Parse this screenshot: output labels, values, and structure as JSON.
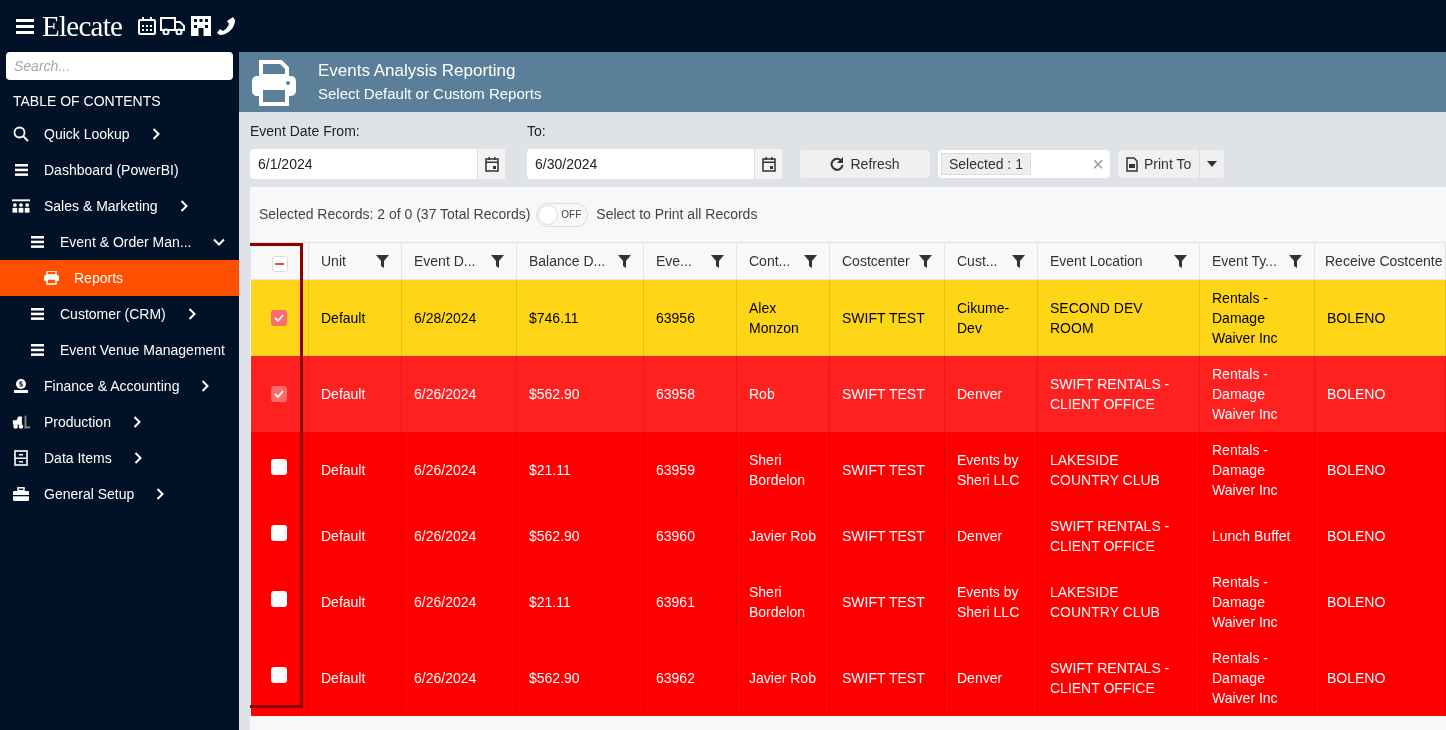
{
  "app": {
    "brand": "Elecate"
  },
  "sidebar": {
    "search_placeholder": "Search...",
    "heading": "TABLE OF CONTENTS",
    "items": [
      {
        "label": "Quick Lookup",
        "expanded": false,
        "selected": false
      },
      {
        "label": "Dashboard (PowerBI)",
        "selected": false
      },
      {
        "label": "Sales & Marketing",
        "expanded": false,
        "selected": false,
        "children": [
          {
            "label": "Event & Order Man...",
            "expanded": true,
            "selected": false,
            "children": [
              {
                "label": "Reports",
                "selected": true
              }
            ]
          },
          {
            "label": "Customer (CRM)",
            "expanded": false,
            "selected": false
          },
          {
            "label": "Event Venue Management",
            "selected": false
          }
        ]
      },
      {
        "label": "Finance & Accounting",
        "expanded": false,
        "selected": false
      },
      {
        "label": "Production",
        "expanded": false,
        "selected": false
      },
      {
        "label": "Data Items",
        "expanded": false,
        "selected": false
      },
      {
        "label": "General Setup",
        "expanded": false,
        "selected": false
      }
    ]
  },
  "header": {
    "title": "Events Analysis Reporting",
    "subtitle": "Select Default or Custom Reports"
  },
  "filters": {
    "from_label": "Event Date From:",
    "from_value": "6/1/2024",
    "to_label": "To:",
    "to_value": "6/30/2024",
    "refresh": "Refresh",
    "selected_tag": "Selected : 1",
    "clear": "×",
    "print": "Print To"
  },
  "summary": {
    "text": "Selected Records: 2 of 0 (37 Total Records)",
    "toggle_on": false,
    "toggle_label": "OFF",
    "toggle_caption": "Select to Print all Records"
  },
  "table": {
    "partly_checked": true,
    "columns": [
      {
        "label": "Unit",
        "filter": true
      },
      {
        "label": "Event D...",
        "filter": true
      },
      {
        "label": "Balance D...",
        "filter": true
      },
      {
        "label": "Eve...",
        "filter": true
      },
      {
        "label": "Cont...",
        "filter": true
      },
      {
        "label": "Costcenter",
        "filter": true
      },
      {
        "label": "Cust...",
        "filter": true
      },
      {
        "label": "Event Location",
        "filter": true
      },
      {
        "label": "Event Ty...",
        "filter": true
      },
      {
        "label": "Receive Costcente",
        "filter": false
      }
    ],
    "rows": [
      {
        "checked": true,
        "color": "#ffd617",
        "cells": [
          "Default",
          "6/28/2024",
          "$746.11",
          "63956",
          "Alex Monzon",
          "SWIFT TEST",
          "Cikume-Dev",
          "SECOND DEV ROOM",
          "Rentals - Damage Waiver Inc",
          "BOLENO"
        ]
      },
      {
        "checked": true,
        "color": "#ff2020",
        "cells": [
          "Default",
          "6/26/2024",
          "$562.90",
          "63958",
          "Rob",
          "SWIFT TEST",
          "Denver",
          "SWIFT RENTALS - CLIENT OFFICE",
          "Rentals - Damage Waiver Inc",
          "BOLENO"
        ]
      },
      {
        "checked": false,
        "color": "#ff0000",
        "cells": [
          "Default",
          "6/26/2024",
          "$21.11",
          "63959",
          "Sheri Bordelon",
          "SWIFT TEST",
          "Events by Sheri LLC",
          "LAKESIDE COUNTRY CLUB",
          "Rentals - Damage Waiver Inc",
          "BOLENO"
        ]
      },
      {
        "checked": false,
        "color": "#ff0000",
        "cells": [
          "Default",
          "6/26/2024",
          "$562.90",
          "63960",
          "Javier Rob",
          "SWIFT TEST",
          "Denver",
          "SWIFT RENTALS - CLIENT OFFICE",
          "Lunch Buffet",
          "BOLENO"
        ]
      },
      {
        "checked": false,
        "color": "#ff0000",
        "cells": [
          "Default",
          "6/26/2024",
          "$21.11",
          "63961",
          "Sheri Bordelon",
          "SWIFT TEST",
          "Events by Sheri LLC",
          "LAKESIDE COUNTRY CLUB",
          "Rentals - Damage Waiver Inc",
          "BOLENO"
        ]
      },
      {
        "checked": false,
        "color": "#ff0000",
        "cells": [
          "Default",
          "6/26/2024",
          "$562.90",
          "63962",
          "Javier Rob",
          "SWIFT TEST",
          "Denver",
          "SWIFT RENTALS - CLIENT OFFICE",
          "Rentals - Damage Waiver Inc",
          "BOLENO"
        ]
      }
    ]
  }
}
